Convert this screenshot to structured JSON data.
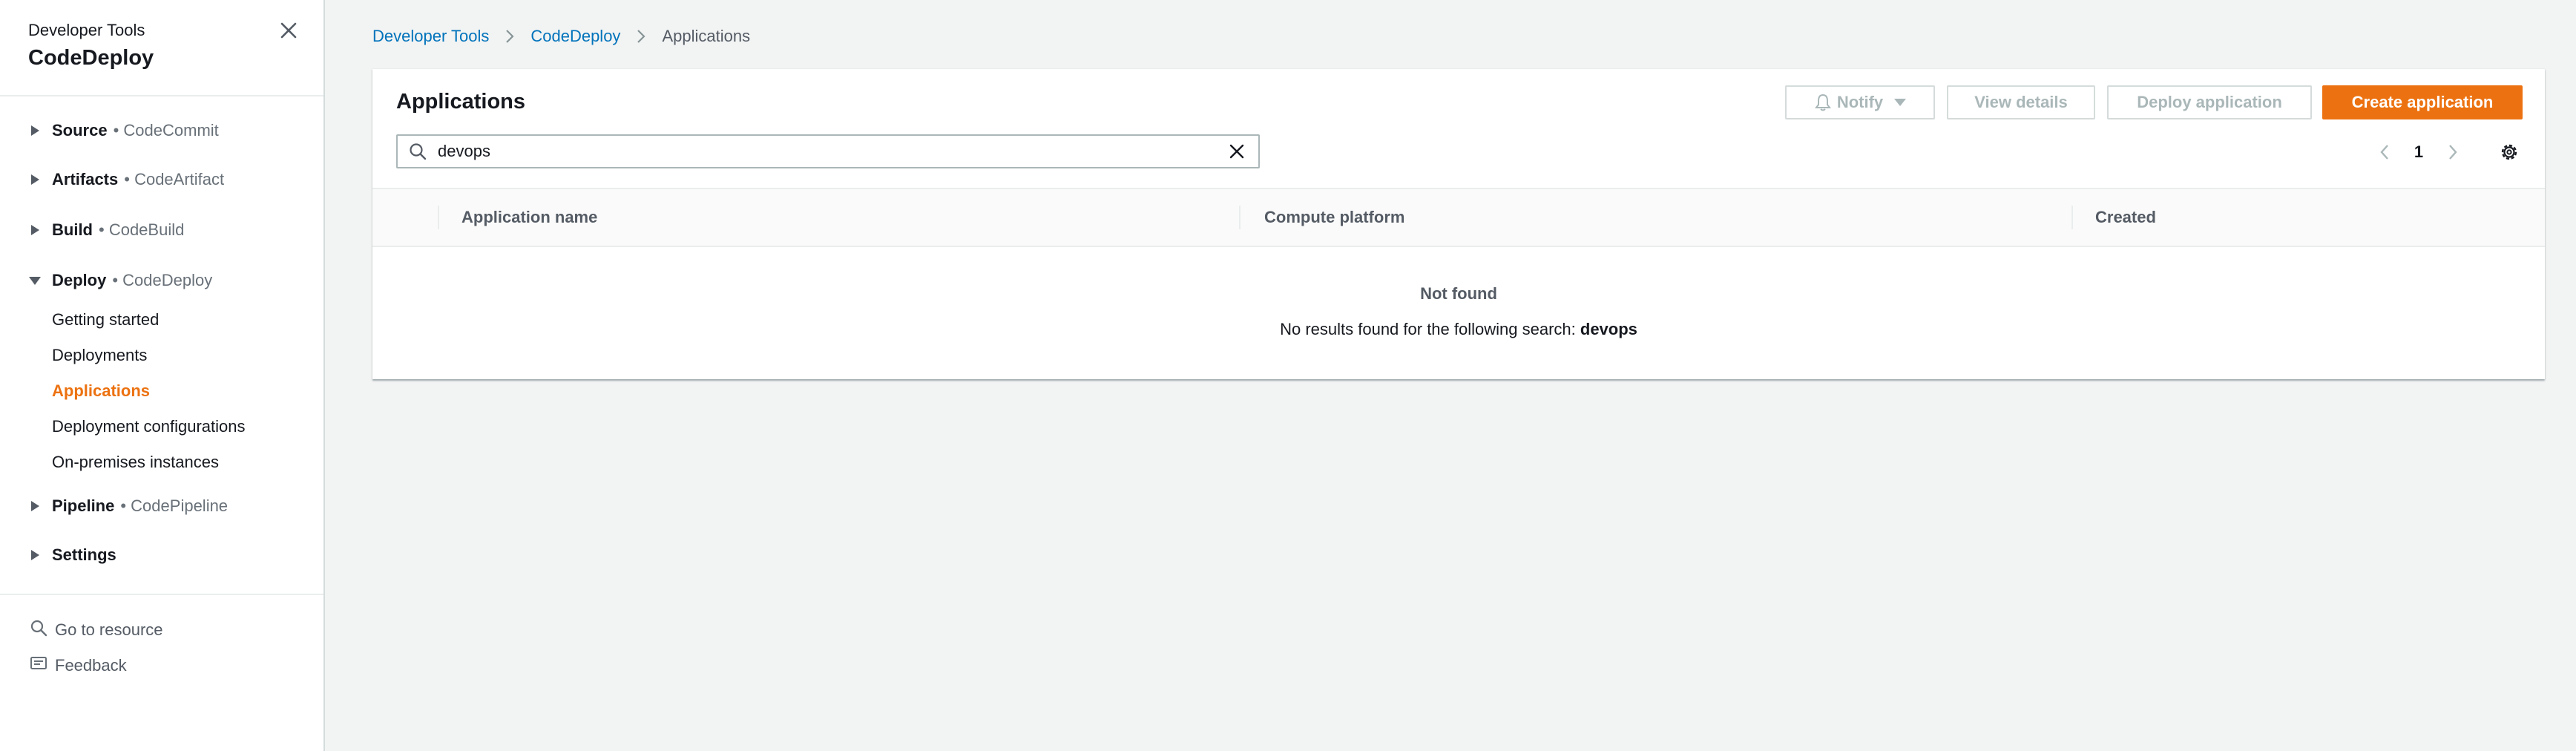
{
  "sidebar": {
    "service": "Developer Tools",
    "title": "CodeDeploy",
    "groups": {
      "source": {
        "name": "Source",
        "sub": "• CodeCommit"
      },
      "artifacts": {
        "name": "Artifacts",
        "sub": "• CodeArtifact"
      },
      "build": {
        "name": "Build",
        "sub": "• CodeBuild"
      },
      "deploy": {
        "name": "Deploy",
        "sub": "• CodeDeploy"
      },
      "pipeline": {
        "name": "Pipeline",
        "sub": "• CodePipeline"
      },
      "settings": {
        "name": "Settings"
      }
    },
    "deploy_items": [
      "Getting started",
      "Deployments",
      "Applications",
      "Deployment configurations",
      "On-premises instances"
    ],
    "active_item": "Applications",
    "footer": {
      "go_to_resource": "Go to resource",
      "feedback": "Feedback"
    }
  },
  "breadcrumb": [
    "Developer Tools",
    "CodeDeploy",
    "Applications"
  ],
  "panel": {
    "title": "Applications",
    "buttons": {
      "notify": "Notify",
      "view_details": "View details",
      "deploy_application": "Deploy application",
      "create_application": "Create application"
    },
    "search": {
      "value": "devops"
    },
    "pagination": {
      "current_page": "1"
    },
    "columns": [
      "Application name",
      "Compute platform",
      "Created"
    ],
    "empty": {
      "title": "Not found",
      "message": "No results found for the following search:",
      "query": "devops"
    }
  },
  "colors": {
    "accent": "#ec7211",
    "link": "#0073bb",
    "disabled": "#aab7b8"
  },
  "icons": [
    "close-icon",
    "caret-right-icon",
    "caret-down-icon",
    "search-icon",
    "clear-icon",
    "bell-icon",
    "chevron-left-icon",
    "chevron-right-icon",
    "gear-icon",
    "feedback-icon"
  ]
}
